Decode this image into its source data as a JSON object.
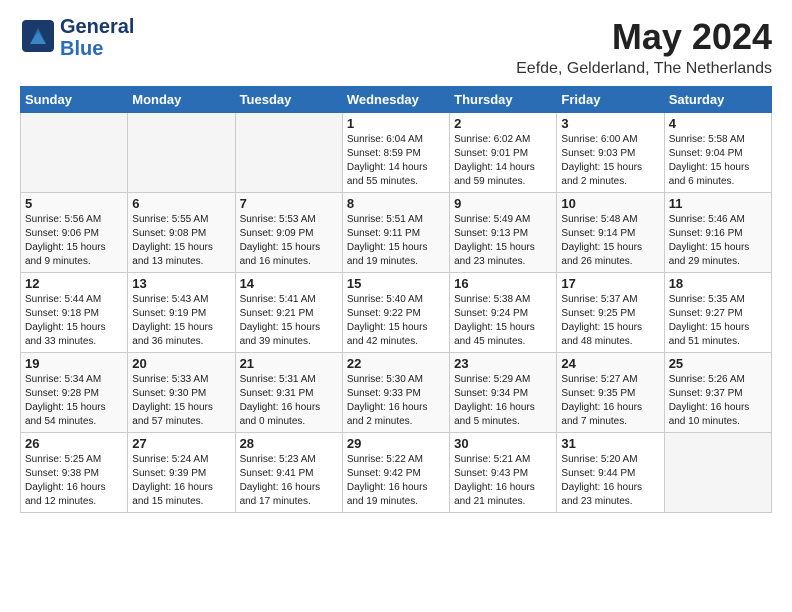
{
  "header": {
    "logo_line1": "General",
    "logo_line2": "Blue",
    "month_title": "May 2024",
    "subtitle": "Eefde, Gelderland, The Netherlands"
  },
  "calendar": {
    "headers": [
      "Sunday",
      "Monday",
      "Tuesday",
      "Wednesday",
      "Thursday",
      "Friday",
      "Saturday"
    ],
    "weeks": [
      [
        {
          "day": "",
          "info": ""
        },
        {
          "day": "",
          "info": ""
        },
        {
          "day": "",
          "info": ""
        },
        {
          "day": "1",
          "info": "Sunrise: 6:04 AM\nSunset: 8:59 PM\nDaylight: 14 hours\nand 55 minutes."
        },
        {
          "day": "2",
          "info": "Sunrise: 6:02 AM\nSunset: 9:01 PM\nDaylight: 14 hours\nand 59 minutes."
        },
        {
          "day": "3",
          "info": "Sunrise: 6:00 AM\nSunset: 9:03 PM\nDaylight: 15 hours\nand 2 minutes."
        },
        {
          "day": "4",
          "info": "Sunrise: 5:58 AM\nSunset: 9:04 PM\nDaylight: 15 hours\nand 6 minutes."
        }
      ],
      [
        {
          "day": "5",
          "info": "Sunrise: 5:56 AM\nSunset: 9:06 PM\nDaylight: 15 hours\nand 9 minutes."
        },
        {
          "day": "6",
          "info": "Sunrise: 5:55 AM\nSunset: 9:08 PM\nDaylight: 15 hours\nand 13 minutes."
        },
        {
          "day": "7",
          "info": "Sunrise: 5:53 AM\nSunset: 9:09 PM\nDaylight: 15 hours\nand 16 minutes."
        },
        {
          "day": "8",
          "info": "Sunrise: 5:51 AM\nSunset: 9:11 PM\nDaylight: 15 hours\nand 19 minutes."
        },
        {
          "day": "9",
          "info": "Sunrise: 5:49 AM\nSunset: 9:13 PM\nDaylight: 15 hours\nand 23 minutes."
        },
        {
          "day": "10",
          "info": "Sunrise: 5:48 AM\nSunset: 9:14 PM\nDaylight: 15 hours\nand 26 minutes."
        },
        {
          "day": "11",
          "info": "Sunrise: 5:46 AM\nSunset: 9:16 PM\nDaylight: 15 hours\nand 29 minutes."
        }
      ],
      [
        {
          "day": "12",
          "info": "Sunrise: 5:44 AM\nSunset: 9:18 PM\nDaylight: 15 hours\nand 33 minutes."
        },
        {
          "day": "13",
          "info": "Sunrise: 5:43 AM\nSunset: 9:19 PM\nDaylight: 15 hours\nand 36 minutes."
        },
        {
          "day": "14",
          "info": "Sunrise: 5:41 AM\nSunset: 9:21 PM\nDaylight: 15 hours\nand 39 minutes."
        },
        {
          "day": "15",
          "info": "Sunrise: 5:40 AM\nSunset: 9:22 PM\nDaylight: 15 hours\nand 42 minutes."
        },
        {
          "day": "16",
          "info": "Sunrise: 5:38 AM\nSunset: 9:24 PM\nDaylight: 15 hours\nand 45 minutes."
        },
        {
          "day": "17",
          "info": "Sunrise: 5:37 AM\nSunset: 9:25 PM\nDaylight: 15 hours\nand 48 minutes."
        },
        {
          "day": "18",
          "info": "Sunrise: 5:35 AM\nSunset: 9:27 PM\nDaylight: 15 hours\nand 51 minutes."
        }
      ],
      [
        {
          "day": "19",
          "info": "Sunrise: 5:34 AM\nSunset: 9:28 PM\nDaylight: 15 hours\nand 54 minutes."
        },
        {
          "day": "20",
          "info": "Sunrise: 5:33 AM\nSunset: 9:30 PM\nDaylight: 15 hours\nand 57 minutes."
        },
        {
          "day": "21",
          "info": "Sunrise: 5:31 AM\nSunset: 9:31 PM\nDaylight: 16 hours\nand 0 minutes."
        },
        {
          "day": "22",
          "info": "Sunrise: 5:30 AM\nSunset: 9:33 PM\nDaylight: 16 hours\nand 2 minutes."
        },
        {
          "day": "23",
          "info": "Sunrise: 5:29 AM\nSunset: 9:34 PM\nDaylight: 16 hours\nand 5 minutes."
        },
        {
          "day": "24",
          "info": "Sunrise: 5:27 AM\nSunset: 9:35 PM\nDaylight: 16 hours\nand 7 minutes."
        },
        {
          "day": "25",
          "info": "Sunrise: 5:26 AM\nSunset: 9:37 PM\nDaylight: 16 hours\nand 10 minutes."
        }
      ],
      [
        {
          "day": "26",
          "info": "Sunrise: 5:25 AM\nSunset: 9:38 PM\nDaylight: 16 hours\nand 12 minutes."
        },
        {
          "day": "27",
          "info": "Sunrise: 5:24 AM\nSunset: 9:39 PM\nDaylight: 16 hours\nand 15 minutes."
        },
        {
          "day": "28",
          "info": "Sunrise: 5:23 AM\nSunset: 9:41 PM\nDaylight: 16 hours\nand 17 minutes."
        },
        {
          "day": "29",
          "info": "Sunrise: 5:22 AM\nSunset: 9:42 PM\nDaylight: 16 hours\nand 19 minutes."
        },
        {
          "day": "30",
          "info": "Sunrise: 5:21 AM\nSunset: 9:43 PM\nDaylight: 16 hours\nand 21 minutes."
        },
        {
          "day": "31",
          "info": "Sunrise: 5:20 AM\nSunset: 9:44 PM\nDaylight: 16 hours\nand 23 minutes."
        },
        {
          "day": "",
          "info": ""
        }
      ]
    ]
  }
}
